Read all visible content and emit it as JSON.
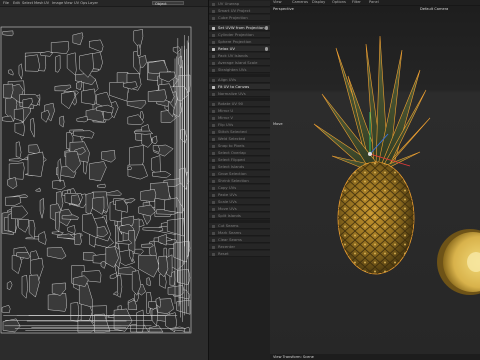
{
  "uv_editor": {
    "menu": [
      "File",
      "Edit",
      "Select",
      "Mesh",
      "UV",
      "Image",
      "View",
      "UV Ops",
      "Layer"
    ],
    "layer_dropdown": "Object"
  },
  "tools_panel": {
    "items": [
      {
        "label": "UV Unwrap",
        "highlight": false
      },
      {
        "label": "Smart UV Project",
        "highlight": false
      },
      {
        "label": "Cube Projection",
        "highlight": false
      },
      {
        "label": "Set UVW from Projection",
        "highlight": true,
        "gear": true
      },
      {
        "label": "Cylinder Projection",
        "highlight": false
      },
      {
        "label": "Sphere Projection",
        "highlight": false
      },
      {
        "label": "Relax UV",
        "highlight": true,
        "gear": true
      },
      {
        "label": "Pack UV Islands",
        "highlight": false
      },
      {
        "label": "Average Island Scale",
        "highlight": false
      },
      {
        "label": "Straighten UVs",
        "highlight": false
      },
      {
        "label": "Align UVs",
        "highlight": false
      },
      {
        "label": "Fit UV to Canvas",
        "highlight": true
      },
      {
        "label": "Normalize UVs",
        "highlight": false
      },
      {
        "label": "Rotate UV 90",
        "highlight": false
      },
      {
        "label": "Mirror U",
        "highlight": false
      },
      {
        "label": "Mirror V",
        "highlight": false
      },
      {
        "label": "Flip UVs",
        "highlight": false
      },
      {
        "label": "Stitch Selected",
        "highlight": false
      },
      {
        "label": "Weld Selected",
        "highlight": false
      },
      {
        "label": "Snap to Pixels",
        "highlight": false
      },
      {
        "label": "Select Overlap",
        "highlight": false
      },
      {
        "label": "Select Flipped",
        "highlight": false
      },
      {
        "label": "Select Islands",
        "highlight": false
      },
      {
        "label": "Grow Selection",
        "highlight": false
      },
      {
        "label": "Shrink Selection",
        "highlight": false
      },
      {
        "label": "Copy UVs",
        "highlight": false
      },
      {
        "label": "Paste UVs",
        "highlight": false
      },
      {
        "label": "Scale UVs",
        "highlight": false
      },
      {
        "label": "Move UVs",
        "highlight": false
      },
      {
        "label": "Split Islands",
        "highlight": false
      },
      {
        "label": "Cut Seams",
        "highlight": false
      },
      {
        "label": "Mark Seams",
        "highlight": false
      },
      {
        "label": "Clear Seams",
        "highlight": false
      },
      {
        "label": "Recenter",
        "highlight": false
      },
      {
        "label": "Reset",
        "highlight": false
      }
    ]
  },
  "viewport": {
    "menu": [
      "View",
      "Cameras",
      "Display",
      "Options",
      "Filter",
      "Panel"
    ],
    "projection": "Perspective",
    "camera": "Default Camera",
    "axis_hint": "Move",
    "bottom_label": "View Transform: Scene",
    "colors": {
      "background": "#232323",
      "horizon": "#2b2b2b",
      "pineapple_body": "#8c6a1e",
      "leaves": "#3f4a2c",
      "highlight": "#f0a030"
    }
  }
}
